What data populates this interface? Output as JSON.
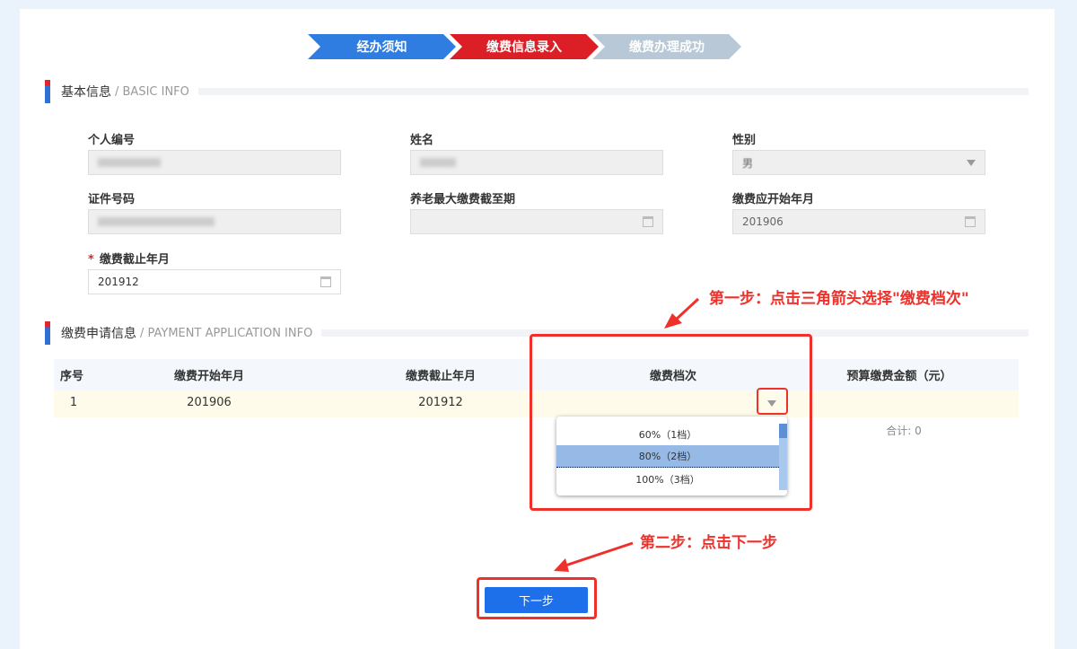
{
  "steps": [
    {
      "label": "经办须知",
      "color": "#2f7de1"
    },
    {
      "label": "缴费信息录入",
      "color": "#dc1f26"
    },
    {
      "label": "缴费办理成功",
      "color": "#b8c8d6"
    }
  ],
  "basic": {
    "title": "基本信息",
    "en": "/ BASIC INFO",
    "fields": {
      "personal_id": {
        "label": "个人编号"
      },
      "name": {
        "label": "姓名"
      },
      "gender": {
        "label": "性别",
        "value": "男"
      },
      "id_no": {
        "label": "证件号码"
      },
      "max_end": {
        "label": "养老最大缴费截至期",
        "value": ""
      },
      "start": {
        "label": "缴费应开始年月",
        "value": "201906"
      },
      "end": {
        "required": "*",
        "label": "缴费截止年月",
        "value": "201912"
      }
    }
  },
  "payment": {
    "title": "缴费申请信息",
    "en": "/ PAYMENT APPLICATION INFO",
    "headers": [
      "序号",
      "缴费开始年月",
      "缴费截止年月",
      "缴费档次",
      "预算缴费金额（元）"
    ],
    "row": {
      "no": "1",
      "start": "201906",
      "end": "201912"
    },
    "total": "合计: 0",
    "options": [
      "60%（1档）",
      "80%（2档）",
      "100%（3档）"
    ],
    "selected": "80%（2档）"
  },
  "annotations": {
    "step1": "第一步：点击三角箭头选择\"缴费档次\"",
    "step2": "第二步：点击下一步"
  },
  "next_button": "下一步"
}
